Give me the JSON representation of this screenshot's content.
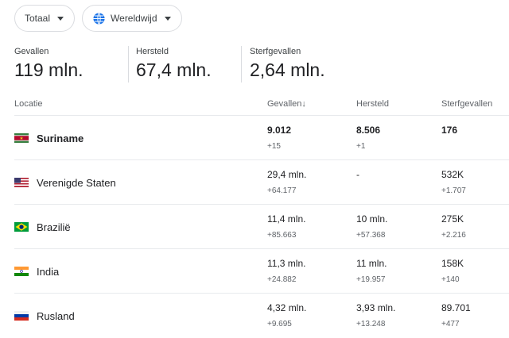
{
  "filters": {
    "total_label": "Totaal",
    "region_label": "Wereldwijd"
  },
  "stats": [
    {
      "label": "Gevallen",
      "value": "119 mln."
    },
    {
      "label": "Hersteld",
      "value": "67,4 mln."
    },
    {
      "label": "Sterfgevallen",
      "value": "2,64 mln."
    }
  ],
  "table": {
    "headers": {
      "location": "Locatie",
      "cases": "Gevallen",
      "sort_arrow": "↓",
      "recovered": "Hersteld",
      "deaths": "Sterfgevallen"
    },
    "rows": [
      {
        "flag": "suriname-flag",
        "location": "Suriname",
        "cases": "9.012",
        "cases_delta": "+15",
        "recovered": "8.506",
        "recovered_delta": "+1",
        "deaths": "176",
        "deaths_delta": ""
      },
      {
        "flag": "usa-flag",
        "location": "Verenigde Staten",
        "cases": "29,4 mln.",
        "cases_delta": "+64.177",
        "recovered": "-",
        "recovered_delta": "",
        "deaths": "532K",
        "deaths_delta": "+1.707"
      },
      {
        "flag": "brazil-flag",
        "location": "Brazilië",
        "cases": "11,4 mln.",
        "cases_delta": "+85.663",
        "recovered": "10 mln.",
        "recovered_delta": "+57.368",
        "deaths": "275K",
        "deaths_delta": "+2.216"
      },
      {
        "flag": "india-flag",
        "location": "India",
        "cases": "11,3 mln.",
        "cases_delta": "+24.882",
        "recovered": "11 mln.",
        "recovered_delta": "+19.957",
        "deaths": "158K",
        "deaths_delta": "+140"
      },
      {
        "flag": "russia-flag",
        "location": "Rusland",
        "cases": "4,32 mln.",
        "cases_delta": "+9.695",
        "recovered": "3,93 mln.",
        "recovered_delta": "+13.248",
        "deaths": "89.701",
        "deaths_delta": "+477"
      }
    ]
  },
  "colors": {
    "accent_blue": "#1a73e8",
    "divider": "#e8eaed"
  }
}
